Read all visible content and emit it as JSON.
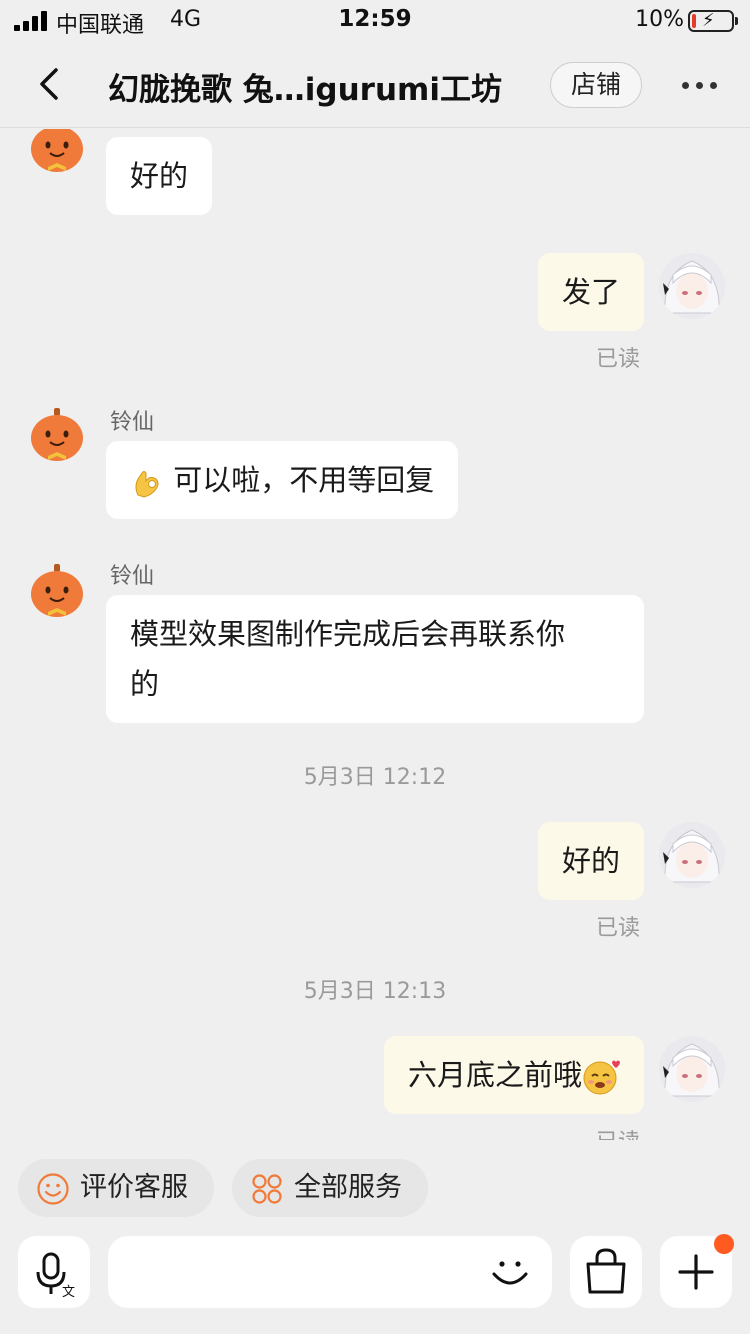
{
  "status_bar": {
    "carrier": "中国联通",
    "network": "4G",
    "time": "12:59",
    "battery_percent": "10%",
    "battery_level": 0.1
  },
  "nav": {
    "title": "幻胧挽歌 兔…igurumi工坊",
    "shop_label": "店铺",
    "back_icon": "chevron-left-icon",
    "more_icon": "ellipsis-icon"
  },
  "messages": {
    "m1": {
      "text": "好的"
    },
    "m2": {
      "text": "发了",
      "read": "已读"
    },
    "m3": {
      "sender": "铃仙",
      "emoji": "ok-hand-emoji",
      "text": "可以啦，不用等回复"
    },
    "m4": {
      "sender": "铃仙",
      "line1": "模型效果图制作完成后会再联系你",
      "line2": "的"
    },
    "ts1": "5月3日 12:12",
    "m5": {
      "text": "好的",
      "read": "已读"
    },
    "ts2": "5月3日 12:13",
    "m6": {
      "text": "六月底之前哦",
      "emoji": "smiling-face-with-hearts-emoji",
      "read": "已读"
    }
  },
  "quick_actions": {
    "rate": "评价客服",
    "all_services": "全部服务"
  },
  "input": {
    "placeholder": ""
  },
  "colors": {
    "accent": "#ef7a3a",
    "background": "#efeff0",
    "outgoing_bubble": "#fdf9e8",
    "incoming_bubble": "#ffffff",
    "notification": "#ff5a1f"
  }
}
